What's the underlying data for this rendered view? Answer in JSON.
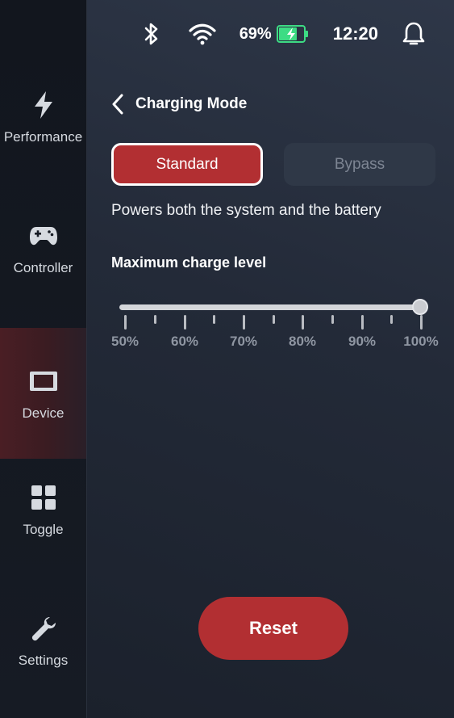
{
  "sidebar": {
    "items": [
      {
        "label": "Performance",
        "icon": "lightning-icon"
      },
      {
        "label": "Controller",
        "icon": "gamepad-icon"
      },
      {
        "label": "Device",
        "icon": "device-icon",
        "active": true
      },
      {
        "label": "Toggle",
        "icon": "grid-icon"
      },
      {
        "label": "Settings",
        "icon": "wrench-icon"
      }
    ]
  },
  "status_bar": {
    "battery_percent": "69%",
    "time": "12:20",
    "battery_charging": true
  },
  "header": {
    "title": "Charging Mode"
  },
  "modes": {
    "standard_label": "Standard",
    "bypass_label": "Bypass",
    "selected": "Standard"
  },
  "description": "Powers both the system and the battery",
  "charge_slider": {
    "title": "Maximum charge level",
    "value_percent": 100,
    "tick_labels": [
      "50%",
      "60%",
      "70%",
      "80%",
      "90%",
      "100%"
    ]
  },
  "reset_label": "Reset",
  "colors": {
    "accent": "#b22f32",
    "battery": "#3ddc84"
  }
}
